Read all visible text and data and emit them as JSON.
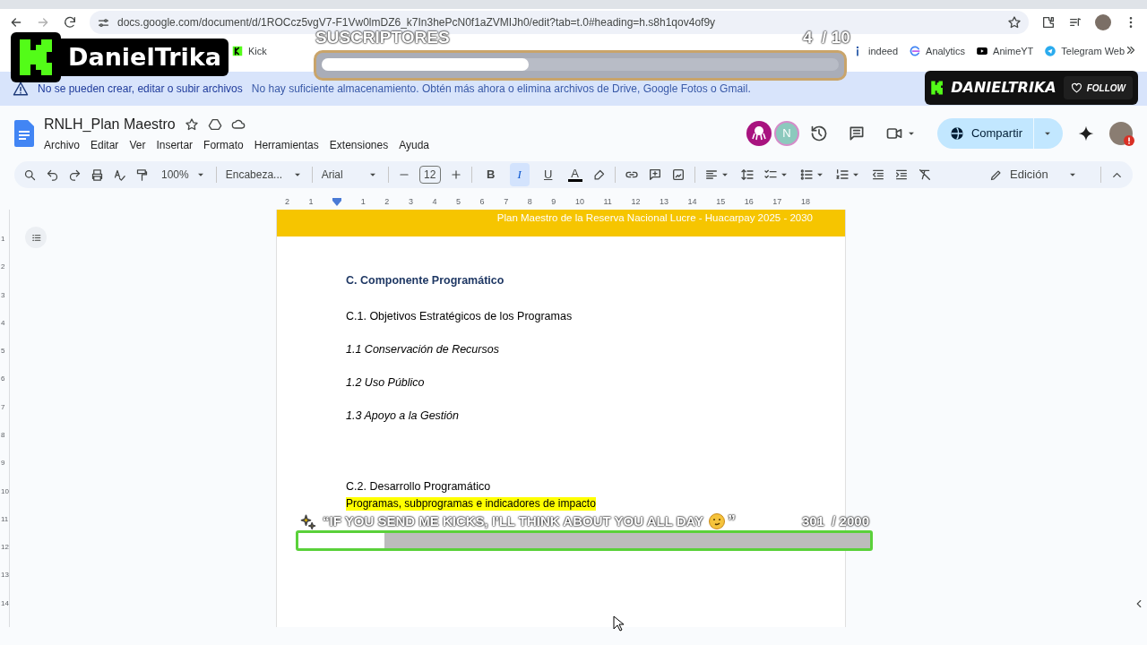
{
  "browser": {
    "url": "docs.google.com/document/d/1ROCcz5vgV7-F1Vw0lmDZ6_k7In3hePcN0f1aZVMIJh0/edit?tab=t.0#heading=h.s8h1qov4of9y",
    "bookmarks_left": [
      {
        "kind": "kick",
        "label": "Kick"
      }
    ],
    "bookmarks_right": [
      {
        "kind": "indeed",
        "label": "indeed"
      },
      {
        "kind": "analytics",
        "label": "Analytics"
      },
      {
        "kind": "video",
        "label": "AnimeYT"
      },
      {
        "kind": "telegram",
        "label": "Telegram Web"
      }
    ]
  },
  "banner": {
    "title": "No se pueden crear, editar o subir archivos",
    "message": "No hay suficiente almacenamiento. Obtén más ahora o elimina archivos de Drive, Google Fotos o Gmail."
  },
  "doc": {
    "title": "RNLH_Plan Maestro",
    "menu": [
      "Archivo",
      "Editar",
      "Ver",
      "Insertar",
      "Formato",
      "Herramientas",
      "Extensiones",
      "Ayuda"
    ],
    "collaborators": [
      {
        "kind": "octopus"
      },
      {
        "kind": "letter",
        "label": "N"
      }
    ],
    "share_button": "Compartir"
  },
  "toolbar": {
    "zoom": "100%",
    "style": "Encabeza...",
    "font": "Arial",
    "font_size": "12",
    "format_buttons": [
      {
        "label": "B",
        "selected": false
      },
      {
        "label": "I",
        "selected": true
      },
      {
        "label": "U",
        "selected": false
      }
    ],
    "text_color": {
      "label": "A",
      "color": "#000000"
    },
    "mode": "Edición"
  },
  "ruler": [
    "2",
    "1",
    "1",
    "2",
    "3",
    "4",
    "5",
    "6",
    "7",
    "8",
    "9",
    "10",
    "11",
    "12",
    "13",
    "14",
    "15",
    "16",
    "17",
    "18"
  ],
  "vertical_ruler": [
    "1",
    "2",
    "3",
    "4",
    "5",
    "6",
    "7",
    "8",
    "9",
    "10",
    "11",
    "12",
    "13",
    "14"
  ],
  "page": {
    "header": "Plan Maestro de la Reserva Nacional Lucre - Huacarpay 2025 - 2030",
    "blocks": [
      {
        "kind": "heading",
        "text": "C. Componente Programático"
      },
      {
        "kind": "subheading",
        "text": "C.1. Objetivos Estratégicos de los Programas"
      },
      {
        "kind": "item",
        "text": "1.1 Conservación de Recursos"
      },
      {
        "kind": "item",
        "text": "1.2 Uso Público"
      },
      {
        "kind": "item",
        "text": "1.3 Apoyo a la Gestión"
      },
      {
        "kind": "section",
        "text": "C.2. Desarrollo Programático"
      },
      {
        "kind": "highlight",
        "text": "Programas, subprogramas e indicadores de impacto"
      }
    ]
  },
  "overlay": {
    "brand": "DanielTrika",
    "subs_goal": {
      "label": "SUSCRIPTORES",
      "count": "4",
      "total": "/ 10",
      "level": 0.4
    },
    "follow_card": {
      "name": "DANIELTRIKA",
      "button": "FOLLOW"
    },
    "kicks_goal": {
      "message": "“IF YOU SEND ME KICKS, I'LL THINK ABOUT YOU ALL DAY",
      "closing": "”",
      "count": "301",
      "total": "/ 2000",
      "level": 0.15
    }
  }
}
